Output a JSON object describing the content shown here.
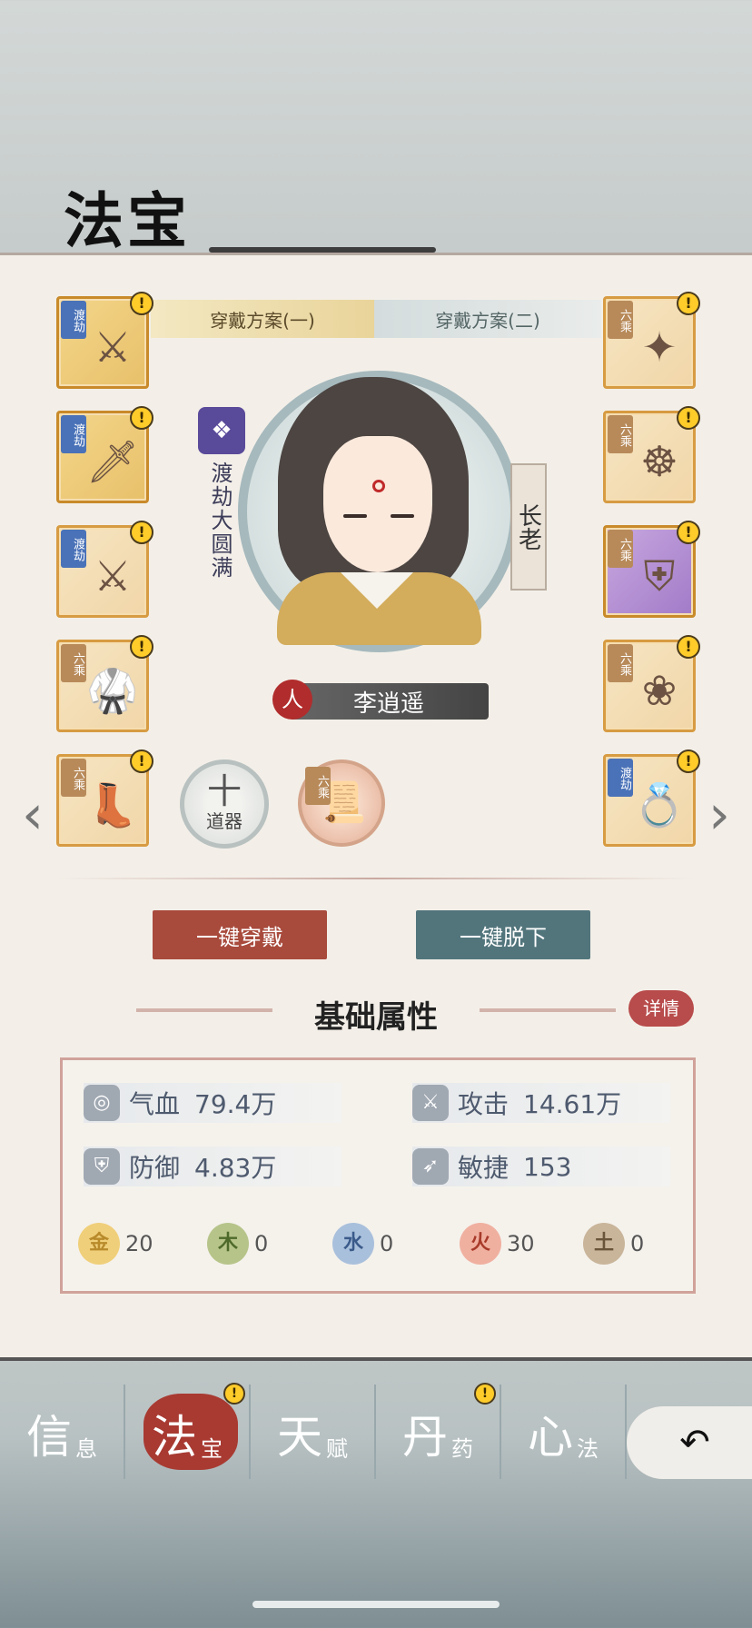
{
  "title": "法宝",
  "tabs": [
    "穿戴方案(一)",
    "穿戴方案(二)"
  ],
  "character": {
    "realm": "渡劫大圆满",
    "rank": "长老",
    "race": "人",
    "name": "李逍遥"
  },
  "left_slots": [
    {
      "badge": "渡劫",
      "glyph": "⚔",
      "alert": "!"
    },
    {
      "badge": "渡劫",
      "glyph": "🗡",
      "alert": "!"
    },
    {
      "badge": "渡劫",
      "glyph": "⚔",
      "alert": "!"
    },
    {
      "badge": "六乘",
      "glyph": "🥋",
      "alert": "!"
    },
    {
      "badge": "六乘",
      "glyph": "👢",
      "alert": "!"
    }
  ],
  "right_slots": [
    {
      "badge": "六乘",
      "glyph": "✦",
      "alert": "!"
    },
    {
      "badge": "六乘",
      "glyph": "☸",
      "alert": "!"
    },
    {
      "badge": "六乘",
      "glyph": "⛨",
      "alert": "!"
    },
    {
      "badge": "六乘",
      "glyph": "❀",
      "alert": "!"
    },
    {
      "badge": "渡劫",
      "glyph": "💍",
      "alert": "!"
    }
  ],
  "tool": {
    "plus": "十",
    "label": "道器"
  },
  "talisman": {
    "badge": "六乘",
    "glyph": "📜"
  },
  "arrows": {
    "left": "‹",
    "right": "›"
  },
  "buttons": {
    "equip_all": "一键穿戴",
    "remove_all": "一键脱下"
  },
  "section": {
    "title": "基础属性",
    "detail": "详情"
  },
  "stats": [
    {
      "icon": "◎",
      "label": "气血",
      "value": "79.4万"
    },
    {
      "icon": "⚔",
      "label": "攻击",
      "value": "14.61万"
    },
    {
      "icon": "⛨",
      "label": "防御",
      "value": "4.83万"
    },
    {
      "icon": "➶",
      "label": "敏捷",
      "value": "153"
    }
  ],
  "elements": [
    {
      "label": "金",
      "value": "20",
      "color": "#f0cf7a"
    },
    {
      "label": "木",
      "value": "0",
      "color": "#b6c48a"
    },
    {
      "label": "水",
      "value": "0",
      "color": "#a9c0dc"
    },
    {
      "label": "火",
      "value": "30",
      "color": "#f0b0a0"
    },
    {
      "label": "土",
      "value": "0",
      "color": "#c9b59a"
    }
  ],
  "nav": [
    {
      "big": "信",
      "small": "息"
    },
    {
      "big": "法",
      "small": "宝",
      "alert": "!"
    },
    {
      "big": "天",
      "small": "赋"
    },
    {
      "big": "丹",
      "small": "药",
      "alert": "!"
    },
    {
      "big": "心",
      "small": "法"
    }
  ],
  "back": "↶"
}
